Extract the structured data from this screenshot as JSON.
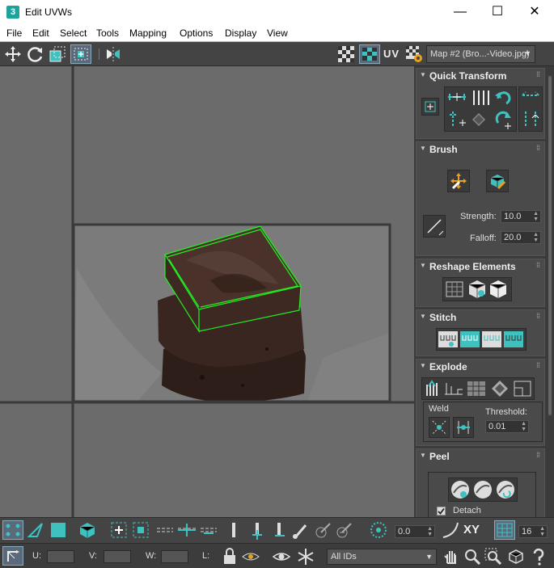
{
  "window": {
    "app_icon": "3",
    "title": "Edit UVWs",
    "minimize_icon": "minimize-icon",
    "maximize_icon": "maximize-icon",
    "close_icon": "close-icon"
  },
  "menu": [
    "File",
    "Edit",
    "Select",
    "Tools",
    "Mapping",
    "Options",
    "Display",
    "View"
  ],
  "toolbar": {
    "uv_label": "UV",
    "map_dropdown": "Map #2 (Bro...-Video.jpg)"
  },
  "panel": {
    "quick_transform": {
      "title": "Quick Transform"
    },
    "brush": {
      "title": "Brush",
      "strength_label": "Strength:",
      "strength_value": "10.0",
      "falloff_label": "Falloff:",
      "falloff_value": "20.0"
    },
    "reshape": {
      "title": "Reshape Elements"
    },
    "stitch": {
      "title": "Stitch"
    },
    "explode": {
      "title": "Explode",
      "weld_label": "Weld",
      "threshold_label": "Threshold:",
      "threshold_value": "0.01"
    },
    "peel": {
      "title": "Peel",
      "detach_label": "Detach",
      "detach_checked": true
    }
  },
  "bottom": {
    "angle_value": "0.0",
    "xy_label": "XY",
    "grid_value": "16",
    "u_label": "U:",
    "v_label": "V:",
    "w_label": "W:",
    "l_label": "L:",
    "ids_dropdown": "All IDs"
  },
  "colors": {
    "accent": "#3fc1c0",
    "uv_wire": "#22ee22",
    "viewport_bg": "#6b6b6b",
    "panel_bg": "#3b3b3b"
  }
}
